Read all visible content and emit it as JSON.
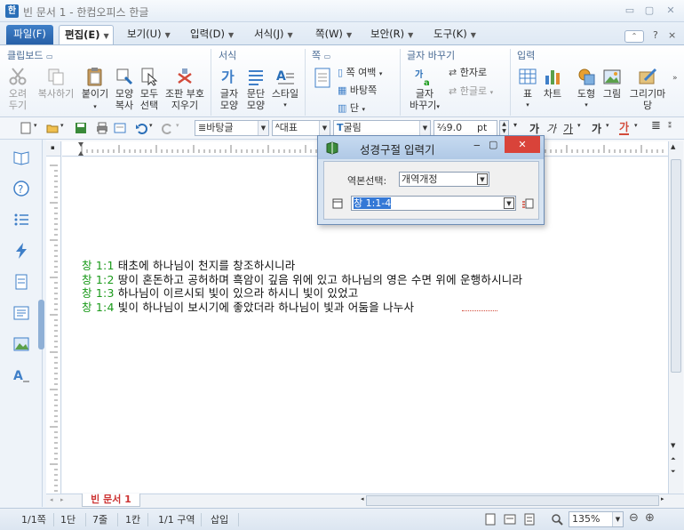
{
  "window": {
    "logo": "한",
    "title": "빈 문서 1 - 한컴오피스 한글",
    "minimize": "▭",
    "restore": "▢",
    "close": "✕"
  },
  "tabs": [
    {
      "label": "파일(F)"
    },
    {
      "label": "편집(E)"
    },
    {
      "label": "보기(U)"
    },
    {
      "label": "입력(D)"
    },
    {
      "label": "서식(J)"
    },
    {
      "label": "쪽(W)"
    },
    {
      "label": "보안(R)"
    },
    {
      "label": "도구(K)"
    }
  ],
  "ribbon": {
    "groups": {
      "clipboard": "클립보드",
      "format": "서식",
      "page": "쪽",
      "font_change": "글자 바꾸기",
      "input": "입력"
    },
    "buttons": {
      "cut": [
        "오려",
        "두기"
      ],
      "copy": "복사하기",
      "paste": "붙이기",
      "shape_copy": [
        "모양",
        "복사"
      ],
      "select_all": [
        "모두",
        "선택"
      ],
      "clear_markup": [
        "조판 부호",
        "지우기"
      ],
      "char_shape": [
        "글자",
        "모양"
      ],
      "para_shape": [
        "문단",
        "모양"
      ],
      "style": "스타일",
      "margin": "쪽 여백",
      "background": "바탕쪽",
      "column": "단",
      "char_change": [
        "글자",
        "바꾸기"
      ],
      "hanja": "한자로",
      "hangul": "한글로",
      "table": "표",
      "chart": "차트",
      "shape": "도형",
      "picture": "그림",
      "drawing": "그리기마당"
    }
  },
  "formatbar": {
    "style": "바탕글",
    "lang": "대표",
    "font": "굴림",
    "size": "9.0",
    "unit": "pt",
    "bold": "가",
    "italic": "가",
    "underline": "가",
    "strike": "가",
    "color": "가"
  },
  "document": {
    "lines": [
      {
        "ref": "창 1:1",
        "text": " 태초에 하나님이 천지를 창조하시니라"
      },
      {
        "ref": "창 1:2",
        "text": " 땅이 혼돈하고 공허하며 흑암이 깊음 위에 있고 하나님의 영은 수면 위에 운행하시니라"
      },
      {
        "ref": "창 1:3",
        "text": " 하나님이 이르시되 빛이 있으라 하시니 빛이 있었고"
      },
      {
        "ref": "창 1:4",
        "text": " 빛이 하나님이 보시기에 좋았더라 하나님이 빛과 어둠을 나누사"
      }
    ],
    "tab": "빈 문서 1"
  },
  "dialog": {
    "title": "성경구절 입력기",
    "version_label": "역본선택:",
    "version_value": "개역개정",
    "verse_value": "창 1:1-4",
    "min": "‒",
    "max": "▢",
    "close": "✕"
  },
  "status": {
    "page": "1/1쪽",
    "column": "1단",
    "line": "7줄",
    "col": "1칸",
    "section": "1/1 구역",
    "mode": "삽입",
    "zoom": "135%"
  },
  "colors": {
    "accent": "#2760a7",
    "verse_ref": "#1a9a1a",
    "dialog_close": "#d9433a"
  }
}
